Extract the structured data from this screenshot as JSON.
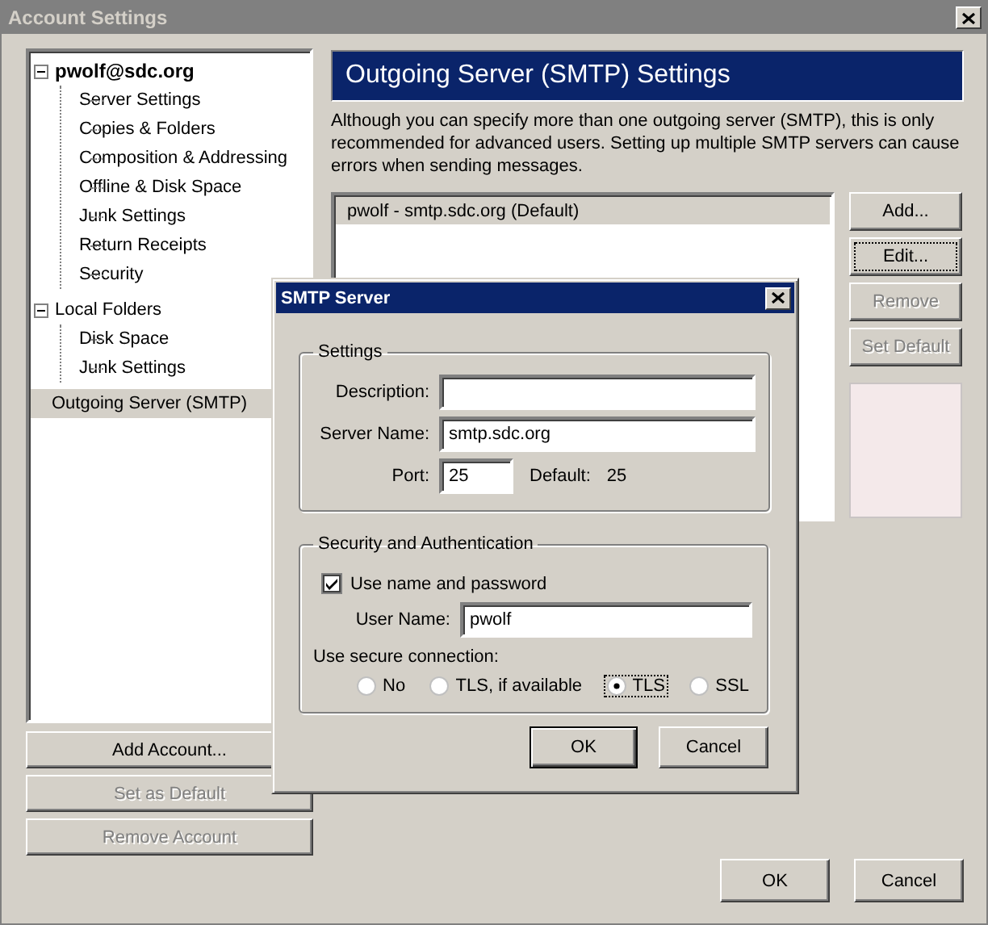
{
  "window": {
    "title": "Account Settings"
  },
  "account_tree": [
    {
      "label": "pwolf@sdc.org",
      "kind": "account",
      "expanded": true,
      "selected": false,
      "children": [
        {
          "label": "Server Settings",
          "selected": false
        },
        {
          "label": "Copies & Folders",
          "selected": false
        },
        {
          "label": "Composition & Addressing",
          "selected": false
        },
        {
          "label": "Offline & Disk Space",
          "selected": false
        },
        {
          "label": "Junk Settings",
          "selected": false
        },
        {
          "label": "Return Receipts",
          "selected": false
        },
        {
          "label": "Security",
          "selected": false
        }
      ]
    },
    {
      "label": "Local Folders",
      "kind": "folders",
      "expanded": true,
      "selected": false,
      "children": [
        {
          "label": "Disk Space",
          "selected": false
        },
        {
          "label": "Junk Settings",
          "selected": false
        }
      ]
    },
    {
      "label": "Outgoing Server (SMTP)",
      "kind": "folders",
      "selected": true
    }
  ],
  "account_buttons": [
    {
      "label": "Add Account...",
      "disabled": false
    },
    {
      "label": "Set as Default",
      "disabled": true
    },
    {
      "label": "Remove Account",
      "disabled": true
    }
  ],
  "panel": {
    "heading": "Outgoing Server (SMTP) Settings",
    "description": "Although you can specify more than one outgoing server (SMTP), this is only recommended for advanced users. Setting up multiple SMTP servers can cause errors when sending messages.",
    "servers": [
      {
        "label": "pwolf - smtp.sdc.org (Default)",
        "selected": true
      }
    ],
    "buttons": [
      {
        "label": "Add...",
        "disabled": false,
        "focused": false
      },
      {
        "label": "Edit...",
        "disabled": false,
        "focused": true
      },
      {
        "label": "Remove",
        "disabled": true,
        "focused": false
      },
      {
        "label": "Set Default",
        "disabled": true,
        "focused": false
      }
    ]
  },
  "footer_buttons": [
    {
      "label": "OK"
    },
    {
      "label": "Cancel"
    }
  ],
  "dialog": {
    "title": "SMTP Server",
    "settings": {
      "legend": "Settings",
      "description_label": "Description:",
      "server_label": "Server Name:",
      "server_value": "smtp.sdc.org",
      "port_label": "Port:",
      "port_value": "25",
      "default_label": "Default:",
      "default_value": "25"
    },
    "security": {
      "legend": "Security and Authentication",
      "use_auth": {
        "label": "Use name and password",
        "checked": true
      },
      "user_label": "User Name:",
      "user_value": "pwolf",
      "secure_label": "Use secure connection:",
      "options": [
        {
          "label": "No",
          "selected": false
        },
        {
          "label": "TLS, if available",
          "selected": false
        },
        {
          "label": "TLS",
          "selected": true
        },
        {
          "label": "SSL",
          "selected": false
        }
      ]
    },
    "buttons": [
      {
        "label": "OK",
        "default": true
      },
      {
        "label": "Cancel",
        "default": false
      }
    ]
  }
}
